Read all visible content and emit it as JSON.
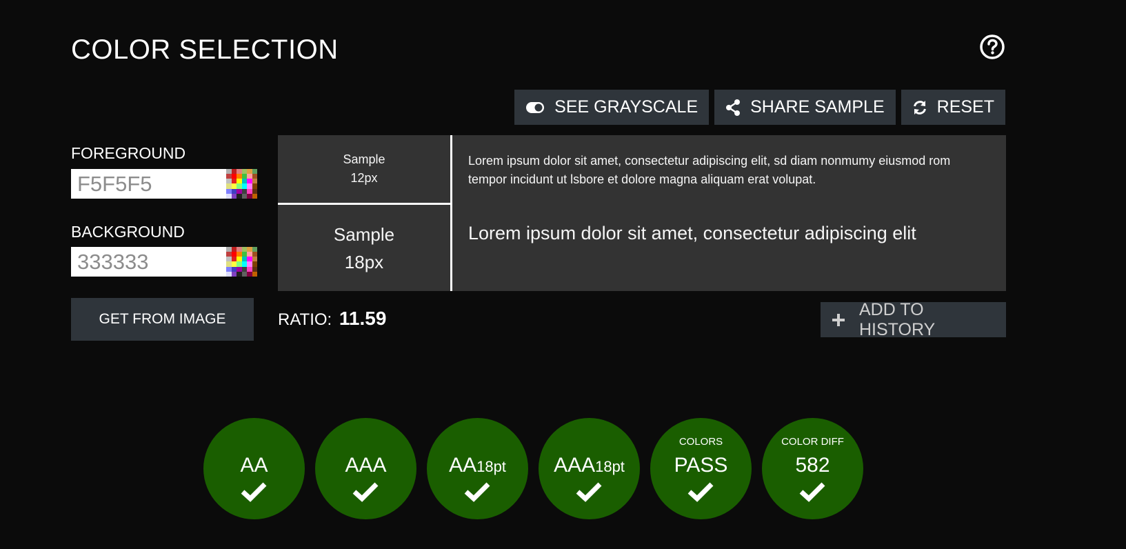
{
  "header": {
    "title": "COLOR SELECTION",
    "help_icon": "question-circle-icon"
  },
  "toolbar": {
    "grayscale_label": "SEE GRAYSCALE",
    "share_label": "SHARE SAMPLE",
    "reset_label": "RESET"
  },
  "foreground": {
    "label": "FOREGROUND",
    "value": "F5F5F5"
  },
  "background": {
    "label": "BACKGROUND",
    "value": "333333"
  },
  "get_from_image_label": "GET FROM IMAGE",
  "sample": {
    "small_label_line1": "Sample",
    "small_label_line2": "12px",
    "small_text": "Lorem ipsum dolor sit amet, consectetur adipiscing elit, sd diam nonmumy eiusmod rom tempor incidunt ut lsbore et dolore magna aliquam erat volupat.",
    "large_label_line1": "Sample",
    "large_label_line2": "18px",
    "large_text": "Lorem ipsum dolor sit amet, consectetur adipiscing elit",
    "fg_color": "#f5f5f5",
    "bg_color": "#333333"
  },
  "ratio": {
    "label": "RATIO:",
    "value": "11.59"
  },
  "add_history_label": "ADD TO HISTORY",
  "badges": [
    {
      "top": "",
      "main": "AA",
      "sub": ""
    },
    {
      "top": "",
      "main": "AAA",
      "sub": ""
    },
    {
      "top": "",
      "main": "AA",
      "sub": "18pt"
    },
    {
      "top": "",
      "main": "AAA",
      "sub": "18pt"
    },
    {
      "top": "COLORS",
      "main": "PASS",
      "sub": ""
    },
    {
      "top": "COLOR DIFF",
      "main": "582",
      "sub": ""
    }
  ],
  "colors": {
    "page_bg": "#0b0b0b",
    "button_bg": "#2f353b",
    "badge_pass": "#1a5e00"
  }
}
